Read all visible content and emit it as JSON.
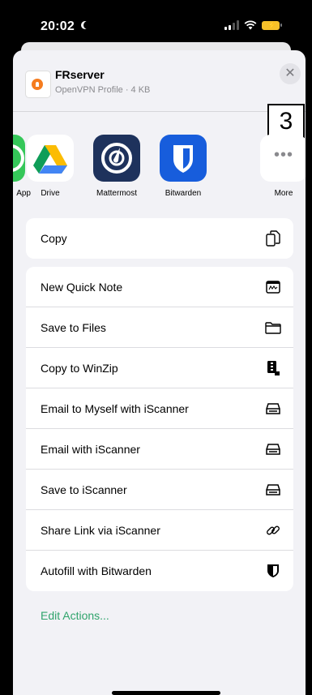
{
  "status_bar": {
    "time": "20:02"
  },
  "file": {
    "name": "FRserver",
    "meta": "OpenVPN Profile · 4 KB"
  },
  "close_symbol": "✕",
  "annotation": "3",
  "apps": [
    {
      "label": "App"
    },
    {
      "label": "Drive"
    },
    {
      "label": "Mattermost"
    },
    {
      "label": "Bitwarden"
    },
    {
      "label": "More",
      "glyph": "•••"
    }
  ],
  "copy_group": [
    {
      "label": "Copy",
      "icon": "copy-icon"
    }
  ],
  "actions": [
    {
      "label": "New Quick Note",
      "icon": "quick-note-icon"
    },
    {
      "label": "Save to Files",
      "icon": "folder-icon"
    },
    {
      "label": "Copy to WinZip",
      "icon": "winzip-icon"
    },
    {
      "label": "Email to Myself with iScanner",
      "icon": "scanner-icon"
    },
    {
      "label": "Email with iScanner",
      "icon": "scanner-icon"
    },
    {
      "label": "Save to iScanner",
      "icon": "scanner-icon"
    },
    {
      "label": "Share Link via iScanner",
      "icon": "link-icon"
    },
    {
      "label": "Autofill with Bitwarden",
      "icon": "bitwarden-shield-icon"
    }
  ],
  "edit_actions": "Edit Actions...",
  "colors": {
    "accent_green": "#30a46c",
    "battery": "#f6c12a"
  }
}
